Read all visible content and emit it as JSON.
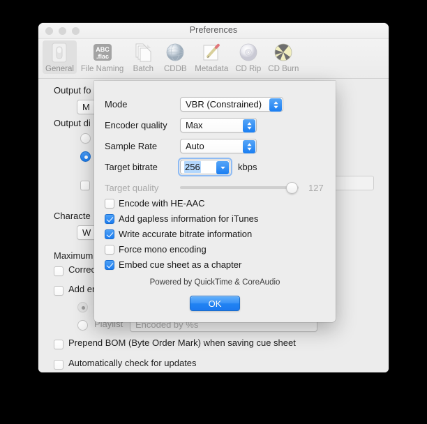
{
  "window": {
    "title": "Preferences",
    "traffic_lights": [
      "close",
      "minimize",
      "zoom"
    ]
  },
  "toolbar": {
    "items": [
      {
        "label": "General",
        "icon": "switch-icon",
        "selected": true
      },
      {
        "label": "File Naming",
        "icon": "abc-flac-icon",
        "selected": false
      },
      {
        "label": "Batch",
        "icon": "documents-icon",
        "selected": false
      },
      {
        "label": "CDDB",
        "icon": "globe-icon",
        "selected": false
      },
      {
        "label": "Metadata",
        "icon": "pencil-pad-icon",
        "selected": false
      },
      {
        "label": "CD Rip",
        "icon": "cd-disc-icon",
        "selected": false
      },
      {
        "label": "CD Burn",
        "icon": "burn-disc-icon",
        "selected": false
      }
    ]
  },
  "background": {
    "labels": {
      "output_format": "Output fo",
      "output_directory": "Output di",
      "character": "Characte",
      "maximum": "Maximum",
      "correct": "Correc",
      "add_encoder": "Add en",
      "playlist": "Playlist",
      "playlist_value": "Encoded by %s",
      "prepend_bom": "Prepend BOM (Byte Order Mark) when saving cue sheet",
      "auto_update": "Automatically check for updates"
    },
    "format_popup_value": "M",
    "character_popup_value": "W"
  },
  "sheet": {
    "rows": [
      {
        "label": "Mode",
        "value": "VBR (Constrained)",
        "control": "popup"
      },
      {
        "label": "Encoder quality",
        "value": "Max",
        "control": "popup"
      },
      {
        "label": "Sample Rate",
        "value": "Auto",
        "control": "popup"
      },
      {
        "label": "Target bitrate",
        "value": "256",
        "control": "combo",
        "unit": "kbps"
      },
      {
        "label": "Target quality",
        "value": "127",
        "control": "slider",
        "disabled": true,
        "slider_percent": 100
      }
    ],
    "checkboxes": [
      {
        "label": "Encode with HE-AAC",
        "checked": false
      },
      {
        "label": "Add gapless information for iTunes",
        "checked": true
      },
      {
        "label": "Write accurate bitrate information",
        "checked": true
      },
      {
        "label": "Force mono encoding",
        "checked": false
      },
      {
        "label": "Embed cue sheet as a chapter",
        "checked": true
      }
    ],
    "powered_by": "Powered by QuickTime & CoreAudio",
    "ok_label": "OK"
  },
  "colors": {
    "accent": "#1a7ef2",
    "window_bg": "#ececec",
    "sheet_bg": "#ededed",
    "selection": "#b3d7fc",
    "disabled_text": "#a9a9a9"
  }
}
